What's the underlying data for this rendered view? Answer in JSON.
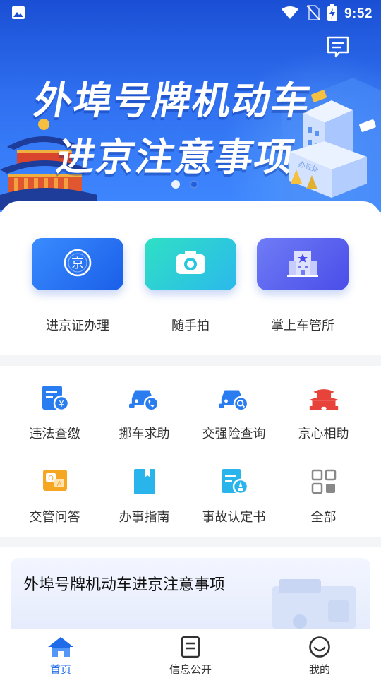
{
  "status_bar": {
    "time": "9:52",
    "icons": [
      "image-icon",
      "wifi-icon",
      "no-sim-icon",
      "battery-charging-icon"
    ]
  },
  "banner": {
    "line1": "外埠号牌机动车",
    "line2": "进京注意事项",
    "building_sign": "办证处",
    "slides": 2,
    "active_slide": 1
  },
  "main_services": [
    {
      "label": "进京证办理",
      "icon": "jing-badge-icon",
      "color": "#1a5fe8"
    },
    {
      "label": "随手拍",
      "icon": "camera-icon",
      "color": "#2bb9ec"
    },
    {
      "label": "掌上车管所",
      "icon": "office-building-icon",
      "color": "#4a4de8"
    }
  ],
  "grid_services": [
    {
      "label": "违法查缴",
      "icon": "fine-payment-icon"
    },
    {
      "label": "挪车求助",
      "icon": "car-phone-icon"
    },
    {
      "label": "交强险查询",
      "icon": "car-search-icon"
    },
    {
      "label": "京心相助",
      "icon": "tiananmen-icon"
    },
    {
      "label": "交管问答",
      "icon": "qa-icon"
    },
    {
      "label": "办事指南",
      "icon": "guide-book-icon"
    },
    {
      "label": "事故认定书",
      "icon": "accident-report-icon"
    },
    {
      "label": "全部",
      "icon": "grid-all-icon"
    }
  ],
  "news": {
    "title": "外埠号牌机动车进京注意事项"
  },
  "bottom_nav": [
    {
      "label": "首页",
      "icon": "home-icon",
      "active": true
    },
    {
      "label": "信息公开",
      "icon": "document-icon",
      "active": false
    },
    {
      "label": "我的",
      "icon": "smiley-icon",
      "active": false
    }
  ],
  "colors": {
    "accent": "#1f6be8",
    "banner_top": "#1a4fd4",
    "banner_bottom": "#3f88ff",
    "icon_blue": "#2a7df0",
    "icon_red": "#e8433a",
    "icon_orange": "#f5a623"
  }
}
